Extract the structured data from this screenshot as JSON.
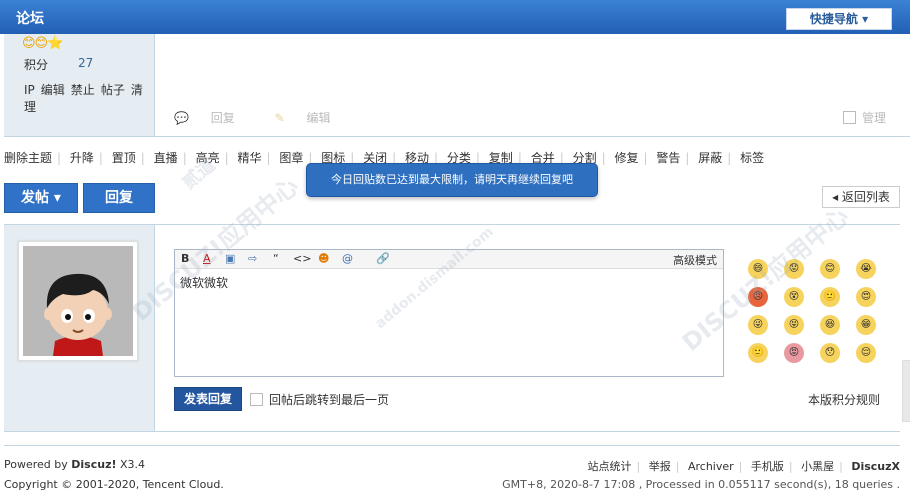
{
  "header": {
    "title": "论坛",
    "quick_nav": "快捷导航 ▾"
  },
  "prev_post": {
    "credit_label": "积分",
    "credit_value": "27",
    "admin_links": [
      "IP",
      "编辑",
      "禁止",
      "帖子",
      "清理"
    ],
    "reply_label": "回复",
    "edit_label": "编辑",
    "manage_label": "管理"
  },
  "mod_links": [
    "删除主题",
    "升降",
    "置顶",
    "直播",
    "高亮",
    "精华",
    "图章",
    "图标",
    "关闭",
    "移动",
    "分类",
    "复制",
    "合并",
    "分割",
    "修复",
    "警告",
    "屏蔽",
    "标签"
  ],
  "tooltip": "今日回贴数已达到最大限制，请明天再继续回复吧",
  "buttons": {
    "post": "发帖 ▾",
    "reply": "回复",
    "back_list": "◂ 返回列表"
  },
  "editor": {
    "toolbar": [
      "B",
      "A",
      "▣",
      "⇨",
      "“",
      "<>",
      "☻",
      "@",
      "🔗"
    ],
    "advanced_mode": "高级模式",
    "content": "微软微软",
    "submit": "发表回复",
    "jump_option": "回帖后跳转到最后一页",
    "rules_link": "本版积分规则"
  },
  "smilies": [
    "😄",
    "😟",
    "😊",
    "😭",
    "😠",
    "😵",
    "🙂",
    "😍",
    "😜",
    "😝",
    "😆",
    "😁",
    "🙂",
    "😡",
    "😯",
    "😌"
  ],
  "watermark": [
    "DISCUZ!应用中心",
    "addon.dismall.com",
    "贰道"
  ],
  "footer": {
    "powered_prefix": "Powered by ",
    "powered_brand": "Discuz!",
    "powered_version": " X3.4",
    "copyright": "Copyright © 2001-2020, Tencent Cloud.",
    "links": [
      "站点统计",
      "举报",
      "Archiver",
      "手机版",
      "小黑屋",
      "DiscuzX"
    ],
    "gmt": "GMT+8, 2020-8-7 17:08 , Processed in 0.055117 second(s), 18 queries ."
  }
}
